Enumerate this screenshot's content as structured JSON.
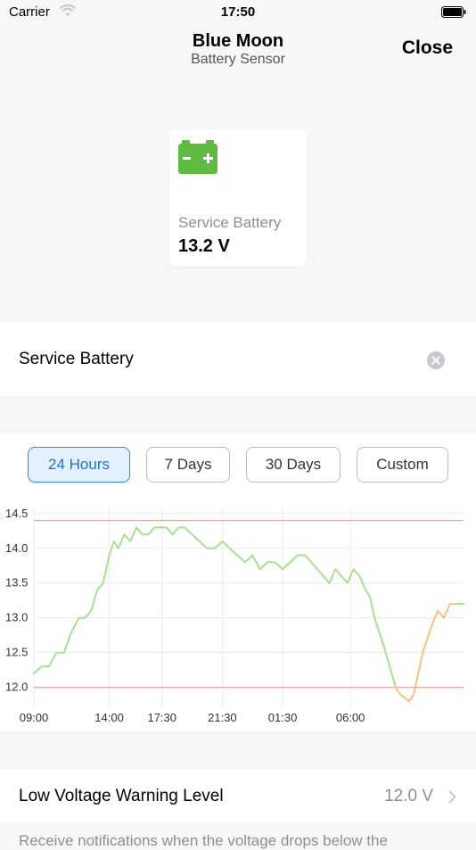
{
  "status_bar": {
    "carrier": "Carrier",
    "time": "17:50"
  },
  "nav": {
    "title": "Blue Moon",
    "subtitle": "Battery Sensor",
    "close_label": "Close"
  },
  "summary_card": {
    "label": "Service Battery",
    "value": "13.2 V",
    "icon": "car-battery-icon",
    "icon_color": "#5fbb3f"
  },
  "battery_row": {
    "label": "Service Battery"
  },
  "range_tabs": [
    {
      "label": "24 Hours",
      "selected": true
    },
    {
      "label": "7 Days",
      "selected": false
    },
    {
      "label": "30 Days",
      "selected": false
    },
    {
      "label": "Custom",
      "selected": false
    }
  ],
  "chart_data": {
    "type": "line",
    "title": "",
    "xlabel": "",
    "ylabel": "",
    "x_ticks": [
      "09:00",
      "14:00",
      "17:30",
      "21:30",
      "01:30",
      "06:00"
    ],
    "y_ticks": [
      "12.0",
      "12.5",
      "13.0",
      "13.5",
      "14.0",
      "14.5"
    ],
    "ylim": [
      11.7,
      14.6
    ],
    "grid": true,
    "thresholds": [
      {
        "value": 14.4,
        "color": "#f0a8a4"
      },
      {
        "value": 12.0,
        "color": "#f0a8a4"
      }
    ],
    "line_color": "#a8e090",
    "low_color": "#f5c27a",
    "series": [
      {
        "x": [
          0,
          0.5,
          1,
          1.5,
          2,
          2.5,
          3,
          3.4,
          3.8,
          4.2,
          4.6,
          5,
          5.3,
          5.6,
          6,
          6.4,
          6.8,
          7.2,
          7.6,
          8,
          8.4,
          8.8,
          9.2,
          9.6,
          10,
          10.5,
          11,
          11.5,
          12,
          12.5,
          13,
          13.5,
          14,
          14.5,
          15,
          15.5,
          16,
          16.5,
          17,
          17.5,
          18,
          18.4,
          18.8,
          19.2,
          19.6,
          20,
          20.4,
          20.8,
          21.2,
          21.6,
          22,
          22.3,
          22.6,
          22.9,
          23.2,
          23.6,
          24
        ],
        "values": [
          12.2,
          12.3,
          12.3,
          12.5,
          12.5,
          12.8,
          13.0,
          13.0,
          13.1,
          13.4,
          13.5,
          13.9,
          14.1,
          14.0,
          14.2,
          14.1,
          14.3,
          14.2,
          14.2,
          14.3,
          14.3,
          14.3,
          14.2,
          14.3,
          14.3,
          14.2,
          14.1,
          14.0,
          14.0,
          14.1,
          14.0,
          13.9,
          13.8,
          13.9,
          13.7,
          13.8,
          13.8,
          13.7,
          13.8,
          13.9,
          13.9,
          13.8,
          13.7,
          13.6,
          13.5,
          13.7,
          13.6,
          13.5,
          13.7,
          13.6,
          13.4,
          13.3,
          13.0,
          12.8,
          12.6,
          12.3,
          12.0
        ]
      },
      {
        "x": [
          24,
          24.3,
          24.6,
          24.9,
          25.2,
          25.5,
          25.8,
          26.1,
          26.4,
          26.8,
          27.2,
          27.6,
          27.9,
          28.2,
          28.5
        ],
        "values": [
          12.0,
          11.9,
          11.85,
          11.8,
          11.9,
          12.2,
          12.5,
          12.7,
          12.9,
          13.1,
          13.0,
          13.2,
          13.2,
          13.2,
          13.2
        ]
      }
    ]
  },
  "warning_row": {
    "label": "Low Voltage Warning Level",
    "value": "12.0 V"
  },
  "footer": {
    "text": "Receive notifications when the voltage drops below the"
  }
}
